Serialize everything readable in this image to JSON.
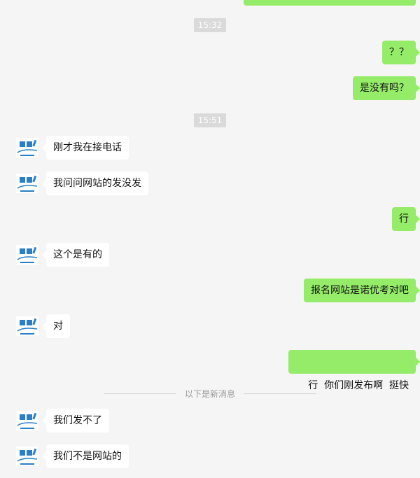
{
  "colors": {
    "background": "#f5f5f5",
    "incoming_bubble": "#ffffff",
    "outgoing_bubble": "#95ec69",
    "timestamp_bg": "#dadada",
    "divider_text": "#9a9a9a"
  },
  "timestamps": {
    "t1": "15:32",
    "t2": "15:51"
  },
  "divider": {
    "new_messages": "以下是新消息"
  },
  "messages": [
    {
      "from": "self",
      "text": "？？"
    },
    {
      "from": "self",
      "text": "是没有吗？"
    },
    {
      "from": "contact",
      "text": "刚才我在接电话"
    },
    {
      "from": "contact",
      "text": "我问问网站的发没发"
    },
    {
      "from": "self",
      "text": "行"
    },
    {
      "from": "contact",
      "text": "这个是有的"
    },
    {
      "from": "self",
      "text": "报名网站是诺优考对吧"
    },
    {
      "from": "contact",
      "text": "对"
    },
    {
      "from": "self",
      "text": "行  你们刚发布啊  挺快"
    },
    {
      "from": "contact",
      "text": "我们发不了"
    },
    {
      "from": "contact",
      "text": "我们不是网站的"
    }
  ]
}
